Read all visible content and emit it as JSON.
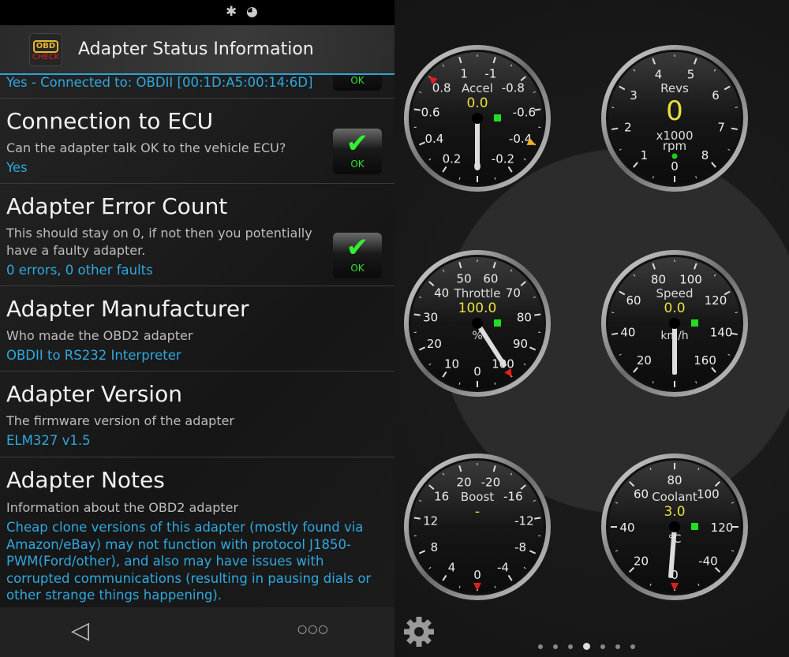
{
  "status_bar": {
    "icons": [
      "bluetooth-icon",
      "gps-signal-icon"
    ]
  },
  "header": {
    "title": "Adapter Status Information",
    "app_icon_text": [
      "OBD",
      "CHECK"
    ]
  },
  "connection_row": {
    "value": "Yes - Connected to: OBDII [00:1D:A5:00:14:6D]",
    "badge": "OK"
  },
  "rows": [
    {
      "title": "Connection to ECU",
      "description": "Can the adapter talk OK to the vehicle ECU?",
      "value": "Yes",
      "badge": "OK"
    },
    {
      "title": "Adapter Error Count",
      "description": "This should stay on 0, if not then you potentially have a faulty adapter.",
      "value": "0 errors, 0 other faults",
      "badge": "OK"
    },
    {
      "title": "Adapter Manufacturer",
      "description": "Who made the OBD2 adapter",
      "value": "OBDII to RS232 Interpreter"
    },
    {
      "title": "Adapter Version",
      "description": "The firmware version of the adapter",
      "value": "ELM327 v1.5"
    },
    {
      "title": "Adapter Notes",
      "description": "Information about the OBD2 adapter",
      "value": "Cheap clone versions of this adapter (mostly found via Amazon/eBay) may not function with protocol J1850-PWM(Ford/other), and also may have issues with corrupted communications (resulting in pausing dials or other strange things happening)."
    }
  ],
  "nav": {
    "back": "◁",
    "more": "○○○"
  },
  "gauges": [
    {
      "name": "Accel",
      "value": "0.0",
      "unit": "",
      "labels": [
        "0",
        "0.2",
        "0.4",
        "0.6",
        "0.8",
        "1",
        "-1",
        "-0.8",
        "-0.6",
        "-0.4",
        "-0.2"
      ],
      "needle_index": 0,
      "indicator": "square",
      "markers": [
        {
          "index": 4,
          "color": "#e02020"
        },
        {
          "index": 9,
          "color": "#f0b020"
        }
      ]
    },
    {
      "name": "Revs",
      "value": "0",
      "unit": "x1000 rpm",
      "labels": [
        "0",
        "1",
        "2",
        "3",
        "4",
        "5",
        "6",
        "7",
        "8"
      ],
      "needle_index": null,
      "indicator": "dot",
      "markers": []
    },
    {
      "name": "Throttle",
      "value": "100.0",
      "unit": "%",
      "labels": [
        "0",
        "10",
        "20",
        "30",
        "40",
        "50",
        "60",
        "70",
        "80",
        "90",
        "100"
      ],
      "needle_index": 10,
      "indicator": "square",
      "markers": [
        {
          "index": 10,
          "color": "#e02020"
        }
      ]
    },
    {
      "name": "Speed",
      "value": "0.0",
      "unit": "km/h",
      "labels": [
        "",
        "20",
        "40",
        "60",
        "80",
        "100",
        "120",
        "140",
        "160"
      ],
      "needle_index": 0,
      "indicator": "square",
      "markers": []
    },
    {
      "name": "Boost",
      "value": "-",
      "unit": "",
      "labels": [
        "0",
        "4",
        "8",
        "12",
        "16",
        "20",
        "-20",
        "-16",
        "-12",
        "-8",
        "-4"
      ],
      "needle_index": null,
      "indicator": "none",
      "markers": [
        {
          "index": 0,
          "color": "#e02020"
        }
      ]
    },
    {
      "name": "Coolant",
      "value": "3.0",
      "unit": "°C",
      "labels": [
        "0",
        "20",
        "40",
        "60",
        "80",
        "100",
        "120",
        "-40"
      ],
      "needle_index": 0.1,
      "indicator": "square",
      "markers": [
        {
          "index": 0,
          "color": "#e02020"
        }
      ]
    }
  ],
  "pager": {
    "count": 7,
    "active": 4
  },
  "settings_icon": "gear-icon"
}
